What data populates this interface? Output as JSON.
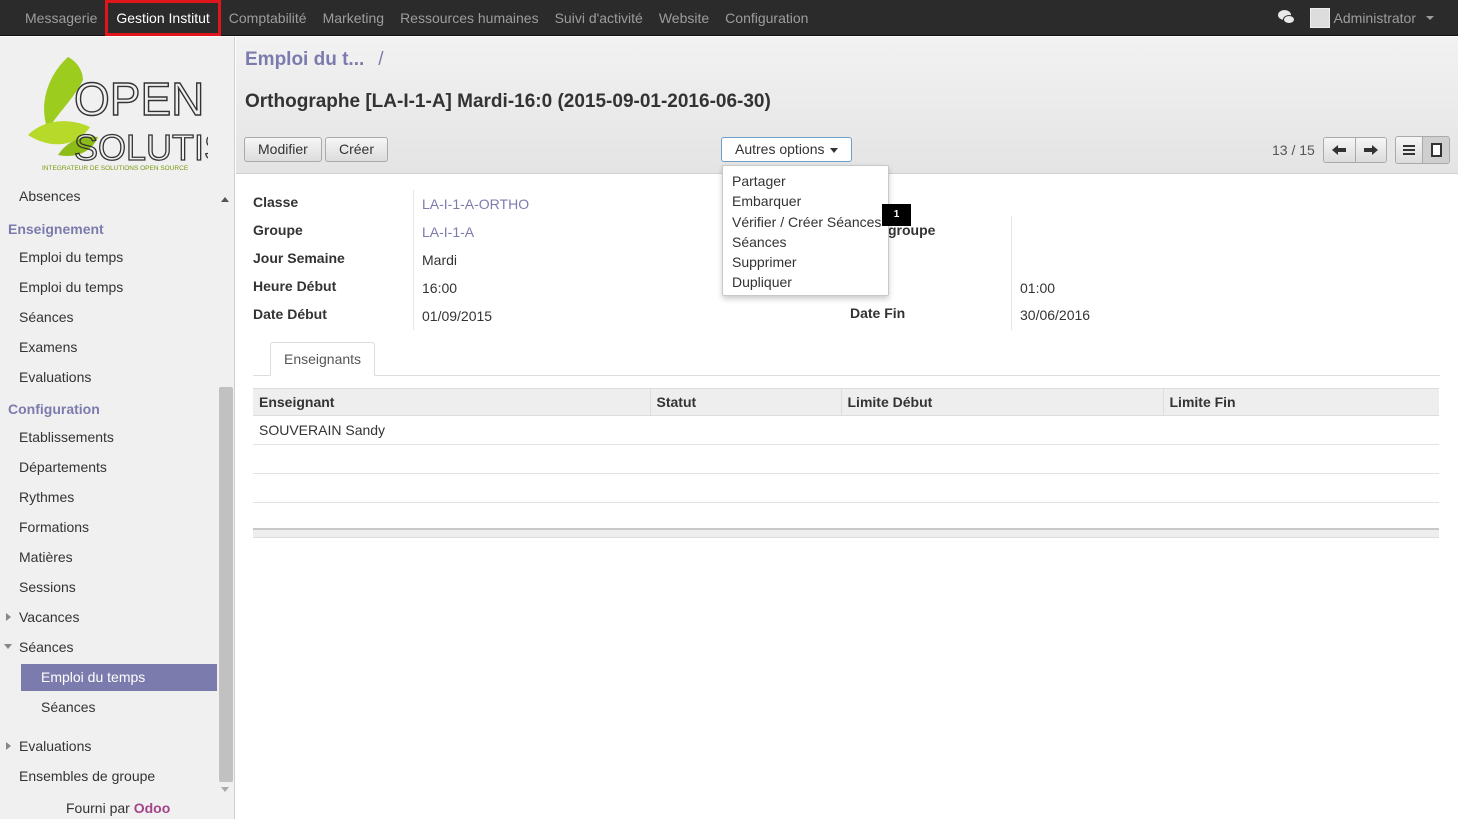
{
  "topbar": {
    "menu": [
      "Messagerie",
      "Gestion Institut",
      "Comptabilité",
      "Marketing",
      "Ressources humaines",
      "Suivi d'activité",
      "Website",
      "Configuration"
    ],
    "active_index": 1,
    "user": "Administrator"
  },
  "logo": {
    "line1": "OPEN",
    "line2": "SOLUTIS",
    "tagline": "INTEGRATEUR DE SOLUTIONS OPEN SOURCE"
  },
  "sidebar": {
    "absences": "Absences",
    "enseignement_header": "Enseignement",
    "enseignement_items": [
      "Emploi du temps",
      "Emploi du temps",
      "Séances",
      "Examens",
      "Evaluations"
    ],
    "configuration_header": "Configuration",
    "configuration_items": [
      "Etablissements",
      "Départements",
      "Rythmes",
      "Formations",
      "Matières",
      "Sessions"
    ],
    "vacances": "Vacances",
    "seances": "Séances",
    "seances_active": "Emploi du temps",
    "seances_sub": "Séances",
    "evaluations": "Evaluations",
    "ensembles": "Ensembles de groupe",
    "footer_prefix": "Fourni par ",
    "footer_brand": "Odoo"
  },
  "header": {
    "breadcrumb": "Emploi du t...",
    "breadcrumb_sep": "/",
    "title": "Orthographe [LA-I-1-A] Mardi-16:0 (2015-09-01-2016-06-30)",
    "modifier": "Modifier",
    "creer": "Créer",
    "autres_options": "Autres options",
    "pager": "13 / 15"
  },
  "dropdown": {
    "items": [
      "Partager",
      "Embarquer",
      "Vérifier / Créer Séances",
      "Séances",
      "Supprimer",
      "Dupliquer"
    ],
    "badge": "1"
  },
  "form": {
    "classe_label": "Classe",
    "classe_value": "LA-I-1-A-ORTHO",
    "groupe_label": "Groupe",
    "groupe_value": "LA-I-1-A",
    "jour_label": "Jour Semaine",
    "jour_value": "Mardi",
    "heure_label": "Heure Début",
    "heure_value": "16:00",
    "date_debut_label": "Date Début",
    "date_debut_value": "01/09/2015",
    "right_groupe_label": "groupe",
    "duree_value": "01:00",
    "date_fin_label": "Date Fin",
    "date_fin_value": "30/06/2016"
  },
  "tabs": {
    "enseignants": "Enseignants"
  },
  "table": {
    "columns": [
      "Enseignant",
      "Statut",
      "Limite Début",
      "Limite Fin"
    ],
    "rows": [
      [
        "SOUVERAIN Sandy",
        "",
        "",
        ""
      ]
    ]
  },
  "colors": {
    "accent": "#7c7bad",
    "topbar": "#2b2b2b",
    "highlight": "#e0161d",
    "brand": "#a24689"
  }
}
